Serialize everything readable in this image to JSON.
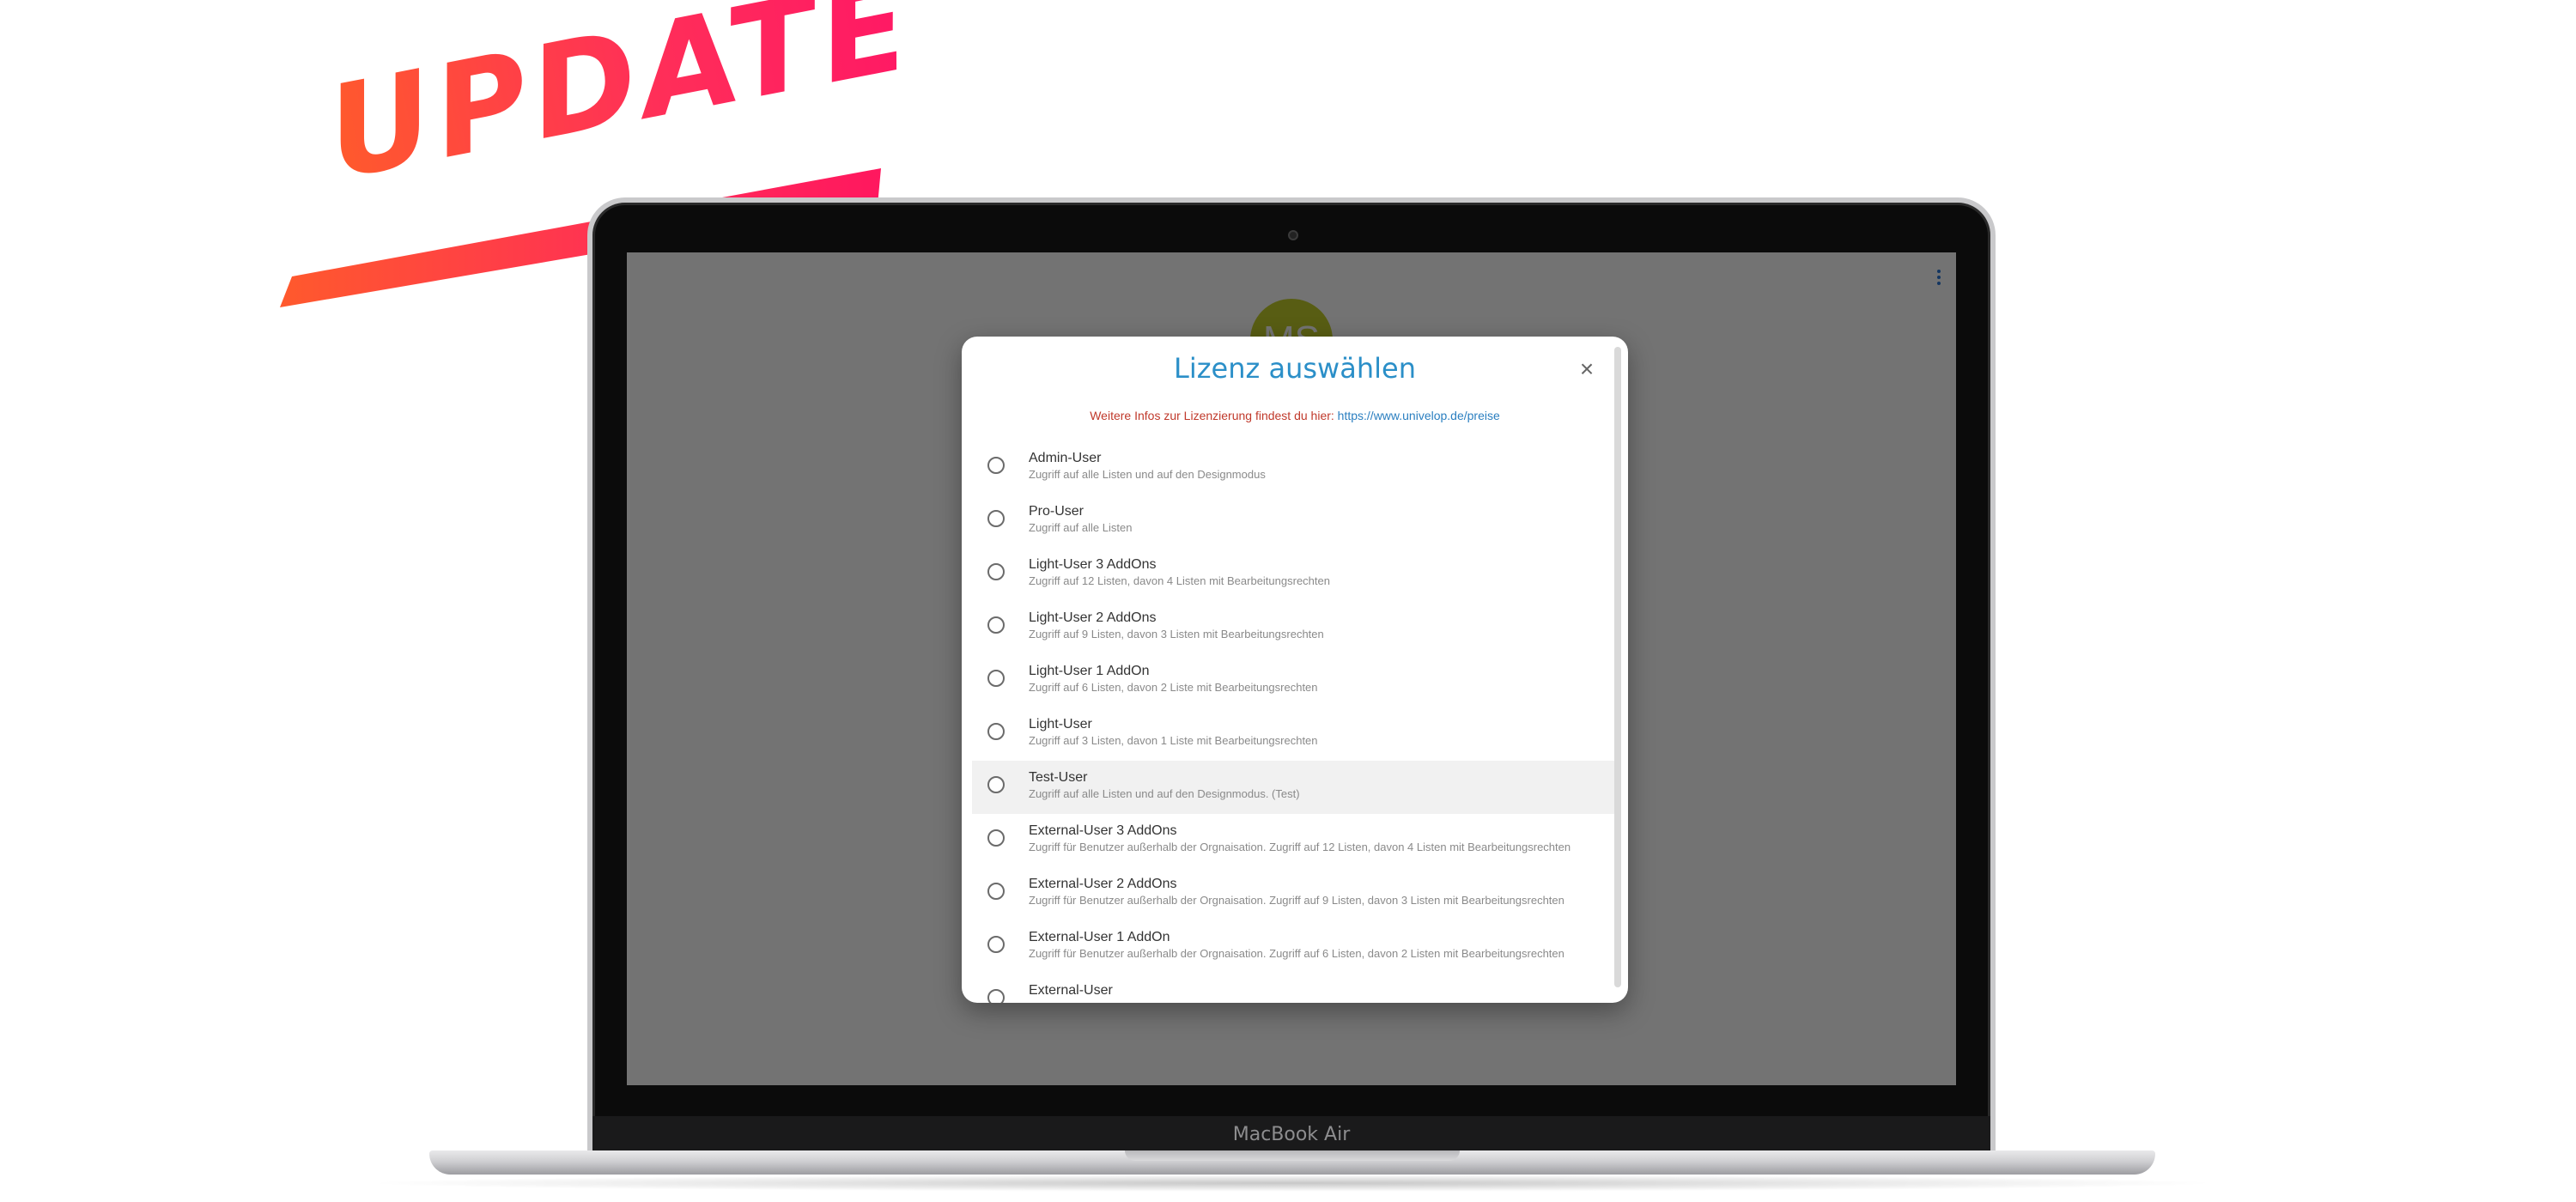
{
  "banner": {
    "text": "UPDATE"
  },
  "device": {
    "label": "MacBook Air"
  },
  "app": {
    "avatar_initials": "MS"
  },
  "dialog": {
    "title": "Lizenz auswählen",
    "close_icon": "close-icon",
    "info_text": "Weitere Infos zur Lizenzierung findest du hier: ",
    "info_link": "https://www.univelop.de/preise",
    "items": [
      {
        "title": "Admin-User",
        "subtitle": "Zugriff auf alle Listen und auf den Designmodus"
      },
      {
        "title": "Pro-User",
        "subtitle": "Zugriff auf alle Listen"
      },
      {
        "title": "Light-User 3 AddOns",
        "subtitle": "Zugriff auf 12 Listen, davon 4 Listen mit Bearbeitungsrechten"
      },
      {
        "title": "Light-User 2 AddOns",
        "subtitle": "Zugriff auf 9 Listen, davon 3 Listen mit Bearbeitungsrechten"
      },
      {
        "title": "Light-User 1 AddOn",
        "subtitle": "Zugriff auf 6 Listen, davon 2 Liste mit Bearbeitungsrechten"
      },
      {
        "title": "Light-User",
        "subtitle": "Zugriff auf 3 Listen, davon 1 Liste mit Bearbeitungsrechten"
      },
      {
        "title": "Test-User",
        "subtitle": "Zugriff auf alle Listen und auf den Designmodus. (Test)"
      },
      {
        "title": "External-User 3 AddOns",
        "subtitle": "Zugriff für Benutzer außerhalb der Orgnaisation. Zugriff auf 12 Listen, davon 4 Listen mit Bearbeitungsrechten"
      },
      {
        "title": "External-User 2 AddOns",
        "subtitle": "Zugriff für Benutzer außerhalb der Orgnaisation. Zugriff auf 9 Listen, davon 3 Listen mit Bearbeitungsrechten"
      },
      {
        "title": "External-User 1 AddOn",
        "subtitle": "Zugriff für Benutzer außerhalb der Orgnaisation. Zugriff auf 6 Listen, davon 2 Listen mit Bearbeitungsrechten"
      },
      {
        "title": "External-User",
        "subtitle": ""
      }
    ]
  }
}
